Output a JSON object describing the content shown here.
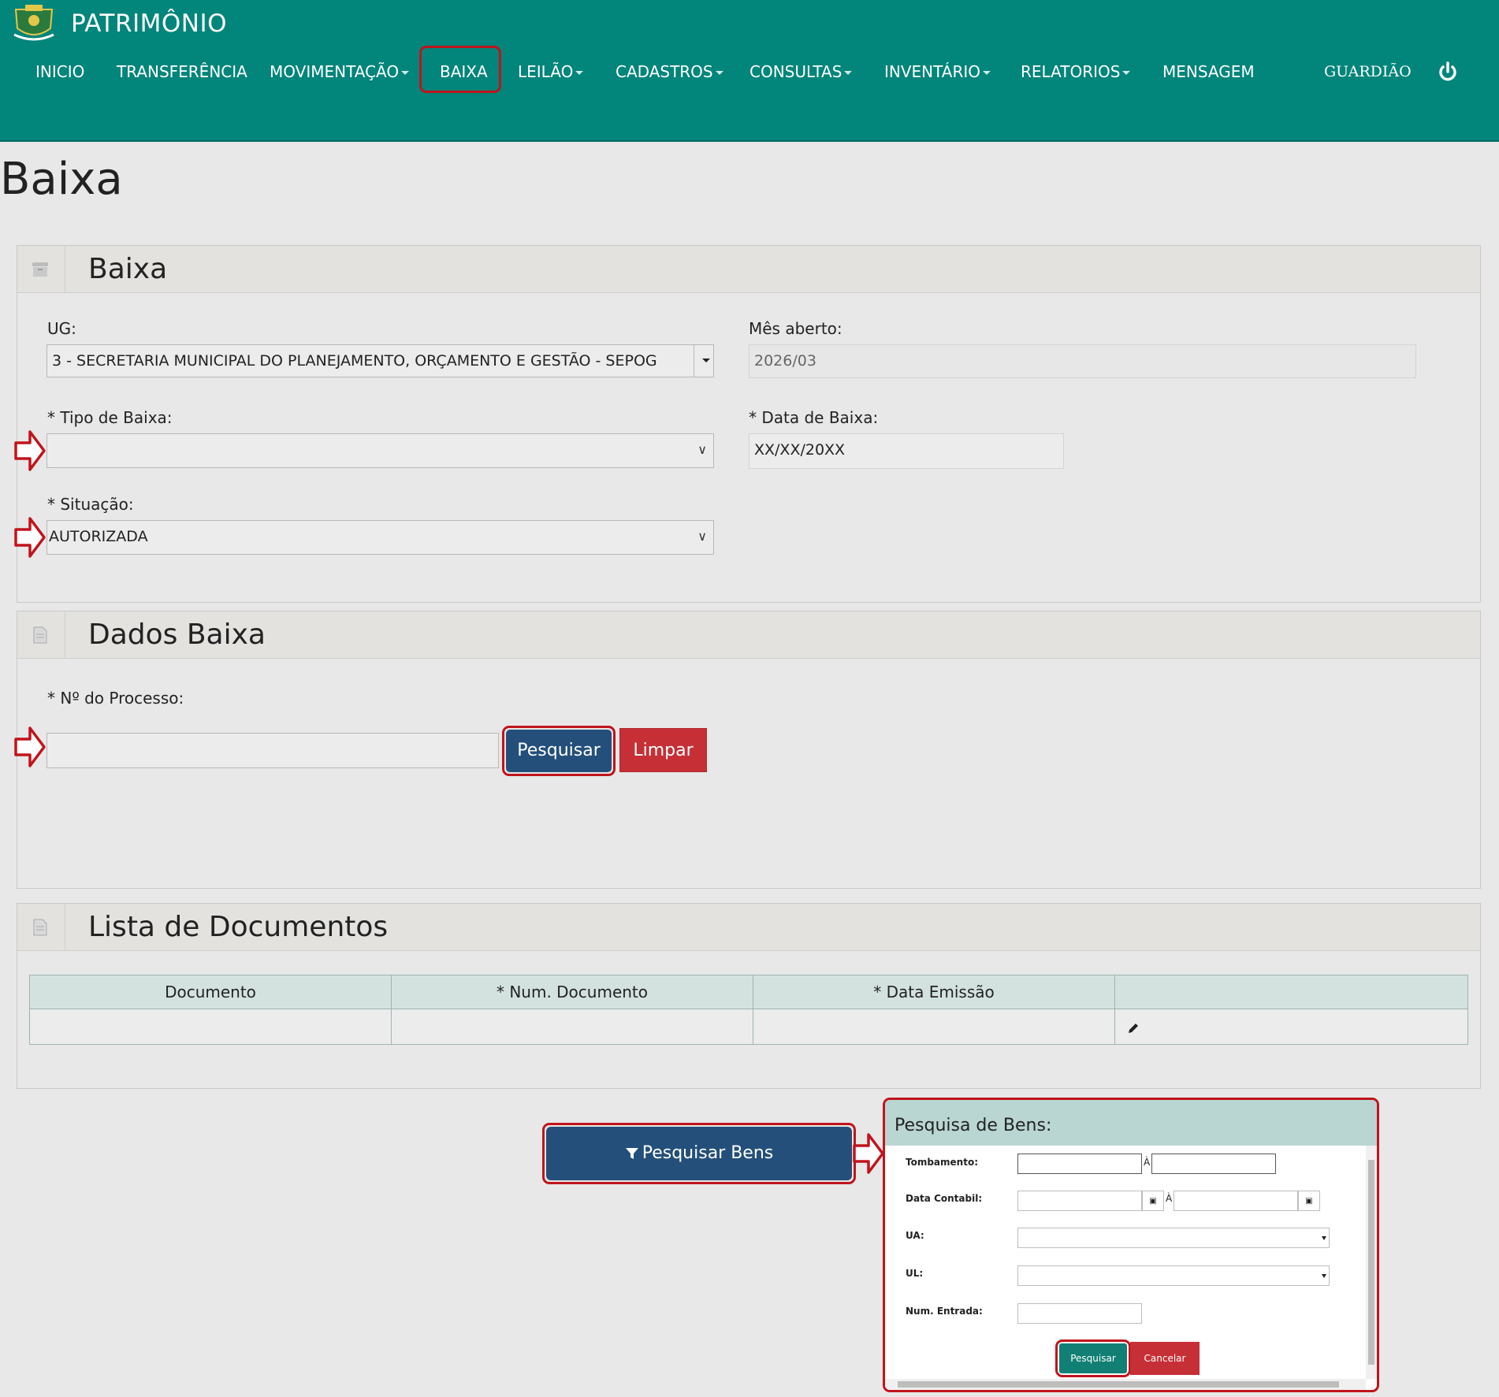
{
  "app": {
    "title": "PATRIMÔNIO"
  },
  "nav": {
    "items": [
      {
        "label": "INICIO"
      },
      {
        "label": "TRANSFERÊNCIA"
      },
      {
        "label": "MOVIMENTAÇÃO"
      },
      {
        "label": "BAIXA"
      },
      {
        "label": "LEILÃO"
      },
      {
        "label": "CADASTROS"
      },
      {
        "label": "CONSULTAS"
      },
      {
        "label": "INVENTÁRIO"
      },
      {
        "label": "RELATORIOS"
      },
      {
        "label": "MENSAGEM"
      }
    ],
    "user": "GUARDIÃO",
    "power_icon": "power-icon"
  },
  "page": {
    "title": "Baixa"
  },
  "panel_baixa": {
    "title": "Baixa",
    "icon": "archive-icon",
    "ug_label": "UG:",
    "ug_value": "3 - SECRETARIA MUNICIPAL DO PLANEJAMENTO, ORÇAMENTO E GESTÃO - SEPOG",
    "mes_label": "Mês aberto:",
    "mes_value": "2026/03",
    "tipo_label": "* Tipo de Baixa:",
    "tipo_value": "",
    "data_label": "* Data de Baixa:",
    "data_value": "XX/XX/20XX",
    "situacao_label": "* Situação:",
    "situacao_value": "AUTORIZADA"
  },
  "panel_dados": {
    "title": "Dados Baixa",
    "icon": "document-icon",
    "processo_label": "* Nº do Processo:",
    "processo_value": "",
    "pesquisar_label": "Pesquisar",
    "limpar_label": "Limpar"
  },
  "panel_docs": {
    "title": "Lista de Documentos",
    "icon": "document-icon",
    "columns": [
      "Documento",
      "* Num. Documento",
      "* Data Emissão",
      ""
    ],
    "edit_icon": "pencil-icon"
  },
  "pesquisar_bens": {
    "label": "Pesquisar Bens",
    "icon": "filter-icon"
  },
  "modal": {
    "title": "Pesquisa de Bens:",
    "tombamento_label": "Tombamento:",
    "range_sep": "À",
    "data_contabil_label": "Data Contabil:",
    "ua_label": "UA:",
    "ul_label": "UL:",
    "num_entrada_label": "Num. Entrada:",
    "pesquisar_label": "Pesquisar",
    "cancelar_label": "Cancelar"
  },
  "colors": {
    "navbar": "#02857a",
    "primary_button": "#244f7a",
    "danger_button": "#c62f36",
    "teal_button": "#117f73",
    "highlight": "#c0141c"
  }
}
